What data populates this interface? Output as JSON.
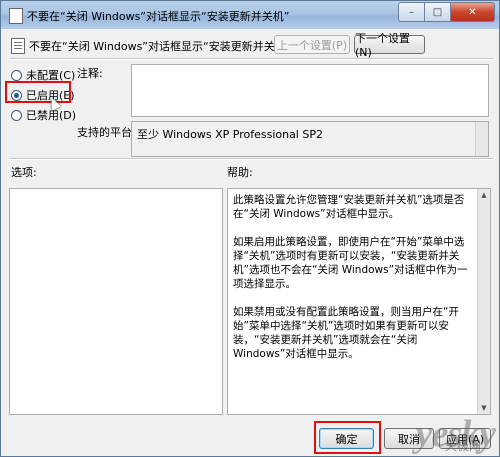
{
  "window": {
    "title": "不要在“关闭 Windows”对话框显示“安装更新并关机”",
    "minimize_glyph": "–",
    "maximize_glyph": "□",
    "close_glyph": "✕"
  },
  "header": {
    "policy_name": "不要在“关闭 Windows”对话框显示“安装更新并关机”",
    "prev_button": "上一个设置(P)",
    "next_button": "下一个设置(N)"
  },
  "state_options": [
    {
      "label": "未配置(C)",
      "checked": false
    },
    {
      "label": "已启用(E)",
      "checked": true
    },
    {
      "label": "已禁用(D)",
      "checked": false
    }
  ],
  "comment": {
    "label": "注释:",
    "value": ""
  },
  "platform": {
    "label": "支持的平台:",
    "value": "至少 Windows XP Professional SP2"
  },
  "options_label": "选项:",
  "help": {
    "label": "帮助:",
    "paragraphs": [
      "此策略设置允许您管理“安装更新并关机”选项是否在“关闭 Windows”对话框中显示。",
      "如果启用此策略设置，即使用户在“开始”菜单中选择“关机”选项时有更新可以安装，“安装更新并关机”选项也不会在“关闭 Windows”对话框中作为一项选择显示。",
      "如果禁用或没有配置此策略设置，则当用户在“开始”菜单中选择“关机”选项时如果有更新可以安装，“安装更新并关机”选项就会在“关闭 Windows”对话框中显示。"
    ]
  },
  "footer": {
    "ok": "确定",
    "cancel": "取消",
    "apply": "应用(A)"
  },
  "watermark": {
    "brand": "yesky",
    "sub": "天极网"
  }
}
